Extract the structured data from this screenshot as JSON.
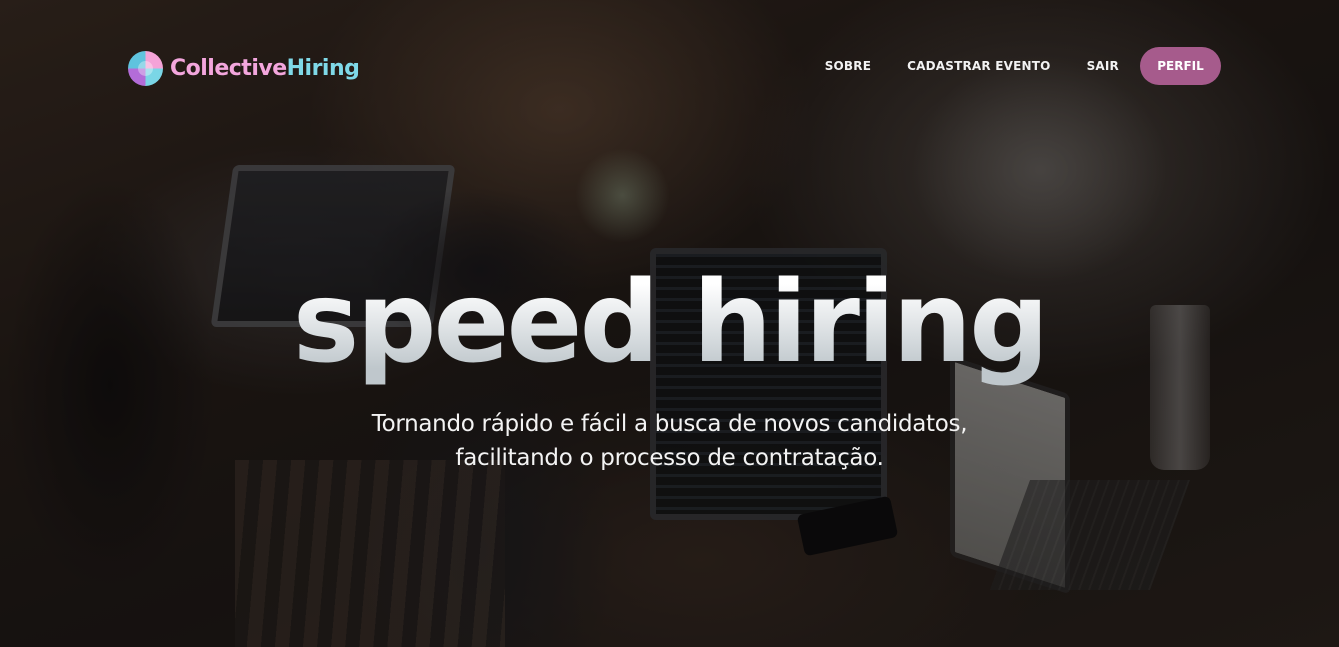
{
  "brand": {
    "name_part1": "Collective",
    "name_part2": "Hiring",
    "logo_icon": "puzzle-globe-icon",
    "colors": {
      "part1": "#f3a6dd",
      "part2": "#7fd9e8"
    }
  },
  "nav": {
    "links": [
      {
        "label": "SOBRE"
      },
      {
        "label": "CADASTRAR EVENTO"
      },
      {
        "label": "SAIR"
      }
    ],
    "cta": {
      "label": "PERFIL",
      "color": "#a65b8c"
    }
  },
  "hero": {
    "headline": "speed hiring",
    "tagline_line1": "Tornando rápido e fácil a busca de novos candidatos,",
    "tagline_line2": "facilitando o processo de contratação."
  }
}
